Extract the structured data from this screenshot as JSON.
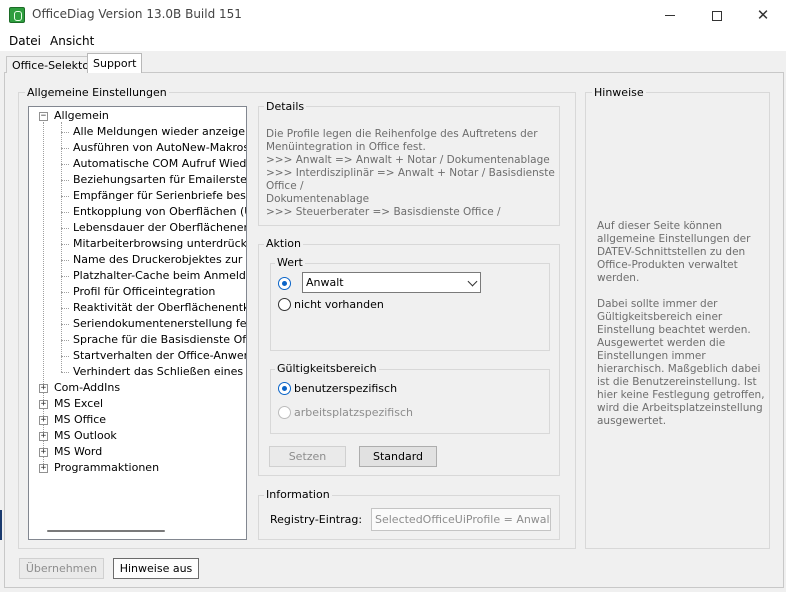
{
  "window": {
    "title": "OfficeDiag   Version 13.0B Build 151",
    "icon": "officediag-app-icon",
    "controls": {
      "minimize": "minimize-icon",
      "maximize": "maximize-icon",
      "close": "✕"
    }
  },
  "menu": {
    "items": [
      "Datei",
      "Ansicht"
    ]
  },
  "tabs": [
    {
      "label": "Office-Selektor",
      "active": false
    },
    {
      "label": "Support",
      "active": true
    }
  ],
  "settings": {
    "group_label": "Allgemeine Einstellungen",
    "tree": {
      "root": {
        "label": "Allgemein",
        "expanded": true,
        "children": [
          "Alle Meldungen wieder anzeigen",
          "Ausführen von AutoNew-Makros",
          "Automatische COM Aufruf Wiederhol",
          "Beziehungsarten für Emailerstellung",
          "Empfänger für Serienbriefe bestimmer",
          "Entkopplung von Oberflächen (UiHos",
          "Lebensdauer der Oberflächenentkop",
          "Mitarbeiterbrowsing unterdrücken",
          "Name des Druckerobjektes zur PDF-",
          "Platzhalter-Cache beim Anmelden akt",
          "Profil für Officeintegration",
          "Reaktivität der Oberflächenentkopplu",
          "Seriendokumentenerstellung festlegen",
          "Sprache für die Basisdienste Office (I",
          "Startverhalten der Office-Anwendung",
          "Verhindert das Schließen eines Textb"
        ]
      },
      "collapsed_nodes": [
        "Com-AddIns",
        "MS Excel",
        "MS Office",
        "MS Outlook",
        "MS Word",
        "Programmaktionen"
      ]
    }
  },
  "details": {
    "label": "Details",
    "lines": [
      "Die Profile legen die Reihenfolge des Auftretens der",
      "Menüintegration in Office fest.",
      ">>> Anwalt => Anwalt + Notar / Dokumentenablage",
      ">>> Interdisziplinär => Anwalt + Notar / Basisdienste Office /",
      "Dokumentenablage",
      ">>> Steuerberater => Basisdienste Office /"
    ]
  },
  "aktion": {
    "label": "Aktion",
    "wert": {
      "label": "Wert",
      "combo_value": "Anwalt",
      "option_nicht_vorhanden": "nicht vorhanden"
    },
    "gueltigkeit": {
      "label": "Gültigkeitsbereich",
      "option_benutzer": "benutzerspezifisch",
      "option_arbeitsplatz": "arbeitsplatzspezifisch"
    },
    "btn_setzen": "Setzen",
    "btn_standard": "Standard"
  },
  "information": {
    "label": "Information",
    "registry_label": "Registry-Eintrag:",
    "registry_value": "SelectedOfficeUiProfile = Anwalt"
  },
  "hinweise": {
    "label": "Hinweise",
    "paragraphs": [
      "Auf dieser Seite können allgemeine Einstellungen der DATEV-Schnittstellen zu den Office-Produkten verwaltet werden.",
      "Dabei sollte immer der Gültigkeitsbereich einer Einstellung beachtet werden. Ausgewertet werden die Einstellungen immer hierarchisch. Maßgeblich dabei ist die Benutzereinstellung. Ist hier keine Festlegung getroffen, wird die Arbeitsplatzeinstellung ausgewertet."
    ]
  },
  "footer": {
    "btn_uebernehmen": "Übernehmen",
    "btn_hinweise_aus": "Hinweise aus"
  }
}
